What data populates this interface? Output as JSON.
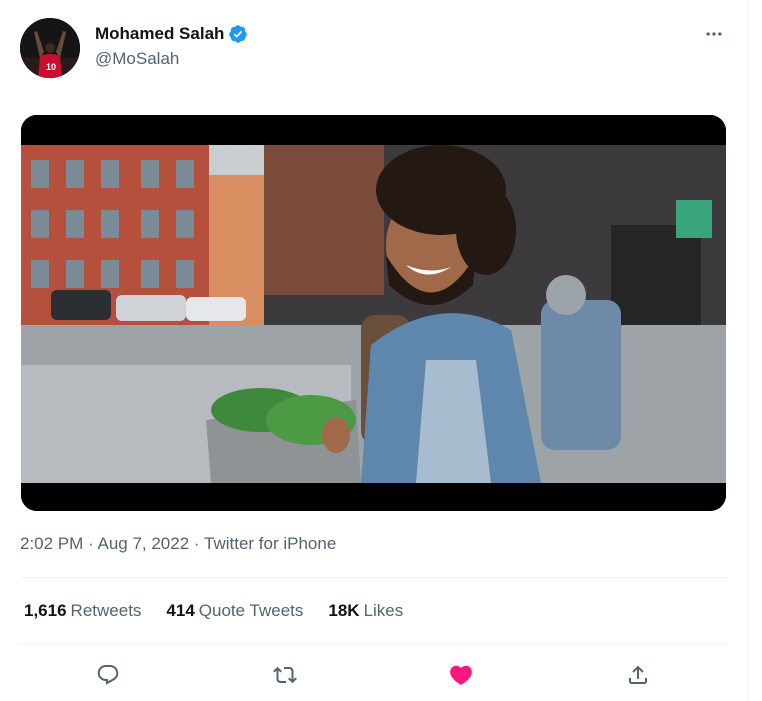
{
  "author": {
    "display_name": "Mohamed Salah",
    "handle": "@MoSalah",
    "verified": true,
    "avatar_icon": "profile-avatar"
  },
  "menu": {
    "icon": "more-horizontal-icon"
  },
  "media": {
    "type": "video"
  },
  "meta": {
    "time": "2:02 PM",
    "sep1": " · ",
    "date": "Aug 7, 2022",
    "sep2": " · ",
    "source": "Twitter for iPhone"
  },
  "stats": {
    "retweets_count": "1,616",
    "retweets_label": "Retweets",
    "quotes_count": "414",
    "quotes_label": "Quote Tweets",
    "likes_count": "18K",
    "likes_label": "Likes"
  },
  "actions": {
    "reply_icon": "reply-icon",
    "retweet_icon": "retweet-icon",
    "like_icon": "heart-icon",
    "share_icon": "share-icon"
  },
  "colors": {
    "verified_blue": "#1d9bf0",
    "like_pink": "#f91880",
    "secondary_text": "#536471",
    "primary_text": "#0f1419"
  }
}
